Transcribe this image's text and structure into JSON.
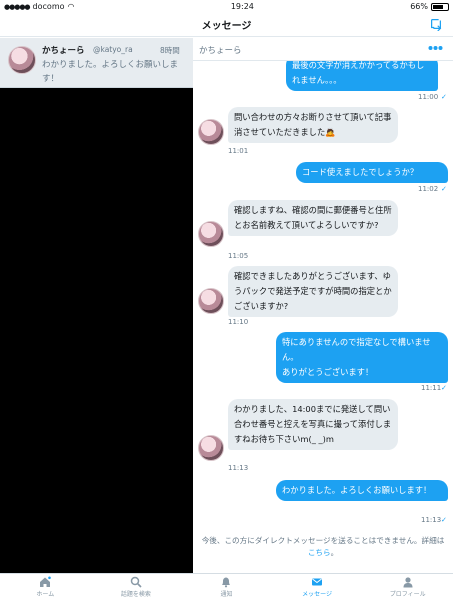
{
  "status": {
    "carrier": "docomo",
    "time": "19:24",
    "battery": "66%"
  },
  "header": {
    "title": "メッセージ"
  },
  "conversation": {
    "name": "かちょーら",
    "handle": "@katyo_ra",
    "time": "8時間",
    "preview": "わかりました。よろしくお願いします！"
  },
  "chat": {
    "title": "かちょーら",
    "messages": [
      {
        "side": "out",
        "text": "最後の文字が消えかかってるかもしれません。。。",
        "time": "11:00"
      },
      {
        "side": "in",
        "text": "問い合わせの方々お断りさせて頂いて記事消させていただきました🙇",
        "time": "11:01"
      },
      {
        "side": "out",
        "text": "コード使えましたでしょうか？",
        "time": "11:02"
      },
      {
        "side": "in",
        "text": "確認しますね、確認の間に郵便番号と住所とお名前教えて頂いてよろしいですか?",
        "time": "11:05"
      },
      {
        "side": "in",
        "text": "確認できましたありがとうございます、ゆうパックで発送予定ですが時間の指定とかございますか?",
        "time": "11:10"
      },
      {
        "side": "out",
        "text": "特にありませんので指定なしで構いません。\nありがとうございます！",
        "time": "11:11"
      },
      {
        "side": "in",
        "text": "わかりました、14:00までに発送して問い合わせ番号と控えを写真に撮って添付しますねお待ち下さいm(_ _)m",
        "time": "11:13"
      },
      {
        "side": "out",
        "text": "わかりました。よろしくお願いします！",
        "time": "11:13"
      }
    ]
  },
  "notice": {
    "text": "今後、この方にダイレクトメッセージを送ることはできません。詳細は",
    "link": "こちら",
    "end": "。"
  },
  "tabs": [
    {
      "label": "ホーム",
      "icon": "home-icon"
    },
    {
      "label": "話題を検索",
      "icon": "search-icon"
    },
    {
      "label": "通知",
      "icon": "bell-icon"
    },
    {
      "label": "メッセージ",
      "icon": "envelope-icon"
    },
    {
      "label": "プロフィール",
      "icon": "person-icon"
    }
  ],
  "colors": {
    "accent": "#1da1f2",
    "incoming_bubble": "#e6ecf0",
    "sidebar_selected": "#e7ecf0"
  }
}
